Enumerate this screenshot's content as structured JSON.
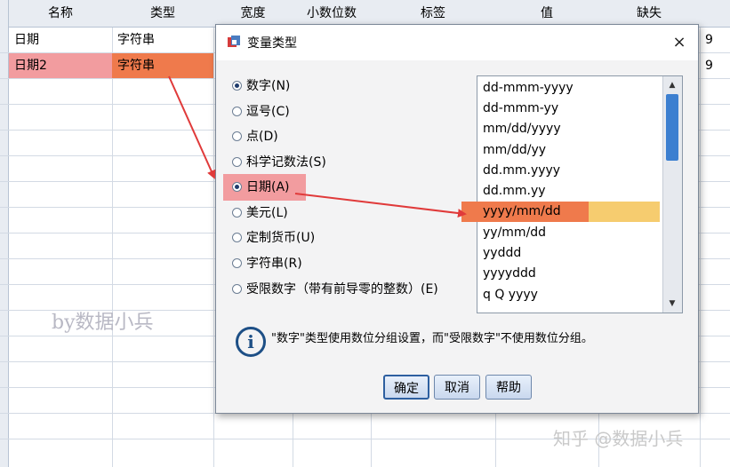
{
  "grid": {
    "columns": [
      "名称",
      "类型",
      "宽度",
      "小数位数",
      "标签",
      "值",
      "缺失"
    ],
    "rows": [
      {
        "name": "日期",
        "type": "字符串",
        "extra": "9"
      },
      {
        "name": "日期2",
        "type": "字符串",
        "extra": "9"
      }
    ]
  },
  "dialog": {
    "title": "变量类型",
    "close": "×",
    "radios": [
      {
        "label": "数字(N)",
        "checked": true
      },
      {
        "label": "逗号(C)",
        "checked": false
      },
      {
        "label": "点(D)",
        "checked": false
      },
      {
        "label": "科学记数法(S)",
        "checked": false
      },
      {
        "label": "日期(A)",
        "checked": true
      },
      {
        "label": "美元(L)",
        "checked": false
      },
      {
        "label": "定制货币(U)",
        "checked": false
      },
      {
        "label": "字符串(R)",
        "checked": false
      },
      {
        "label": "受限数字（带有前导零的整数）(E)",
        "checked": false
      }
    ],
    "formats": [
      "dd-mmm-yyyy",
      "dd-mmm-yy",
      "mm/dd/yyyy",
      "mm/dd/yy",
      "dd.mm.yyyy",
      "dd.mm.yy",
      "yyyy/mm/dd",
      "yy/mm/dd",
      "yyddd",
      "yyyyddd",
      "q Q yyyy"
    ],
    "selected_format": "yyyy/mm/dd",
    "info": "\"数字\"类型使用数位分组设置，而\"受限数字\"不使用数位分组。",
    "buttons": {
      "ok": "确定",
      "cancel": "取消",
      "help": "帮助"
    }
  },
  "watermarks": [
    "by数据小兵",
    "知乎 @数据小兵"
  ],
  "colors": {
    "highlight_pink": "#f29c9f",
    "highlight_orange": "#ef7a4c",
    "arrow_red": "#e03a3a",
    "selection": "#f6cc6f"
  }
}
